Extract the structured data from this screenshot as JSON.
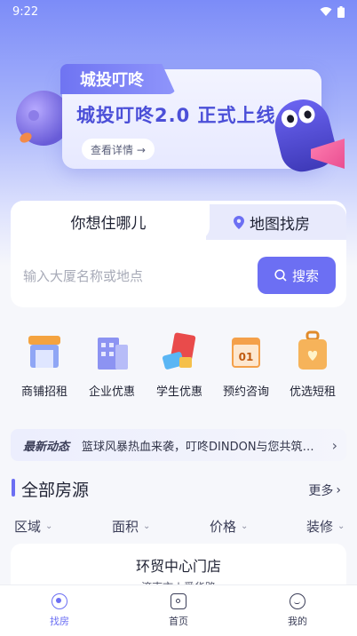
{
  "status_bar": {
    "time": "9:22"
  },
  "banner": {
    "tag": "城投叮咚",
    "headline": "城投叮咚2.0 正式上线",
    "button_label": "查看详情 →"
  },
  "search": {
    "tab_active": "你想住哪儿",
    "tab_map": "地图找房",
    "placeholder": "输入大厦名称或地点",
    "button_label": "搜索"
  },
  "categories": [
    {
      "label": "商铺招租",
      "icon": "shop-icon"
    },
    {
      "label": "企业优惠",
      "icon": "building-icon"
    },
    {
      "label": "学生优惠",
      "icon": "book-coupon-icon"
    },
    {
      "label": "预约咨询",
      "icon": "calendar-icon"
    },
    {
      "label": "优选短租",
      "icon": "luggage-icon"
    }
  ],
  "news": {
    "tag": "最新动态",
    "text": "篮球风暴热血来袭，叮咚DINDON与您共筑青..."
  },
  "section": {
    "title": "全部房源",
    "more": "更多"
  },
  "filters": [
    "区域",
    "面积",
    "价格",
    "装修"
  ],
  "listing": {
    "name": "环贸中心门店",
    "address": "济南市 | 爱华路"
  },
  "bottom_nav": [
    {
      "label": "找房",
      "active": true
    },
    {
      "label": "首页",
      "active": false
    },
    {
      "label": "我的",
      "active": false
    }
  ],
  "colors": {
    "accent": "#6c6ff3",
    "hero_top": "#7c8cf8",
    "background": "#f6f7fb"
  }
}
